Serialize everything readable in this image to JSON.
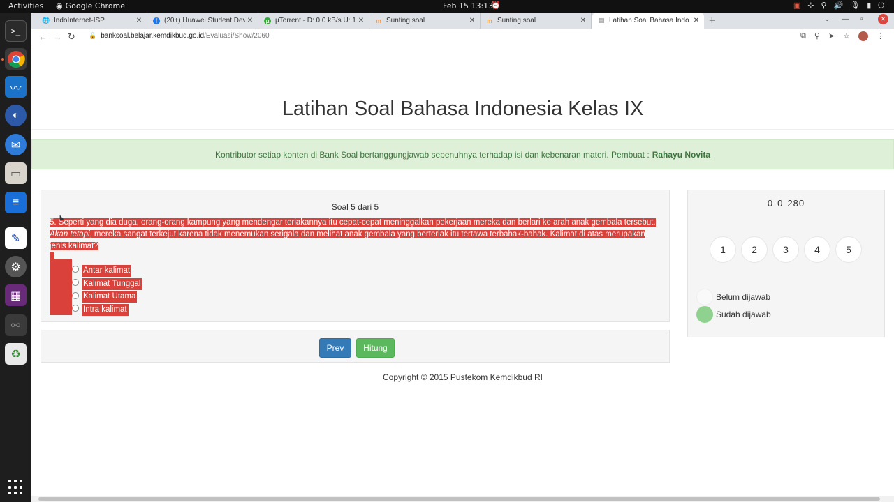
{
  "system_bar": {
    "activities": "Activities",
    "app_name": "Google Chrome",
    "clock": "Feb 15  13:13"
  },
  "browser": {
    "tabs": [
      {
        "title": "IndoInternet-ISP",
        "icon": "globe-icon"
      },
      {
        "title": "(20+) Huawei Student Dev",
        "icon": "facebook-icon"
      },
      {
        "title": "µTorrent - D: 0.0 kB/s U: 1",
        "icon": "utorrent-icon"
      },
      {
        "title": "Sunting soal",
        "icon": "moodle-icon"
      },
      {
        "title": "Sunting soal",
        "icon": "moodle-icon"
      },
      {
        "title": "Latihan Soal Bahasa Indo",
        "icon": "page-icon",
        "active": true
      }
    ],
    "url_host": "banksoal.belajar.kemdikbud.go.id",
    "url_path": "/Evaluasi/Show/2060"
  },
  "page": {
    "title": "Latihan Soal Bahasa Indonesia Kelas IX",
    "notice_text": "Kontributor setiap konten di Bank Soal bertanggungjawab sepenuhnya terhadap isi dan kebenaran materi. Pembuat :",
    "author": "Rahayu Novita",
    "question_header": "Soal 5 dari 5",
    "question": {
      "part1": "5. Seperti yang dia duga, orang-orang kampung yang mendengar teriakannya itu cepat-cepat meninggalkan pekerjaan mereka dan berlari ke arah anak gembala tersebut.",
      "italic": "Akan tetapi",
      "part2": ", mereka sangat terkejut karena tidak menemukan serigala dan melihat anak gembala yang berteriak itu tertawa terbahak-bahak. Kalimat di atas merupakan jenis kalimat?"
    },
    "options": [
      "Antar kalimat",
      "Kalimat Tunggal",
      "Kalimat Utama",
      "Intra kalimat"
    ],
    "buttons": {
      "prev": "Prev",
      "hitung": "Hitung"
    },
    "copyright": "Copyright © 2015 Pustekom Kemdikbud RI",
    "timer": [
      "0",
      "0",
      "280"
    ],
    "question_numbers": [
      "1",
      "2",
      "3",
      "4",
      "5"
    ],
    "legend": {
      "unanswered": "Belum dijawab",
      "answered": "Sudah dijawab"
    }
  },
  "colors": {
    "highlight": "#d9413a",
    "notice_bg": "#dff0d8",
    "notice_text": "#3c763d",
    "prev_button": "#337ab7",
    "hitung_button": "#5cb85c",
    "answered_dot": "#8fd18f"
  }
}
